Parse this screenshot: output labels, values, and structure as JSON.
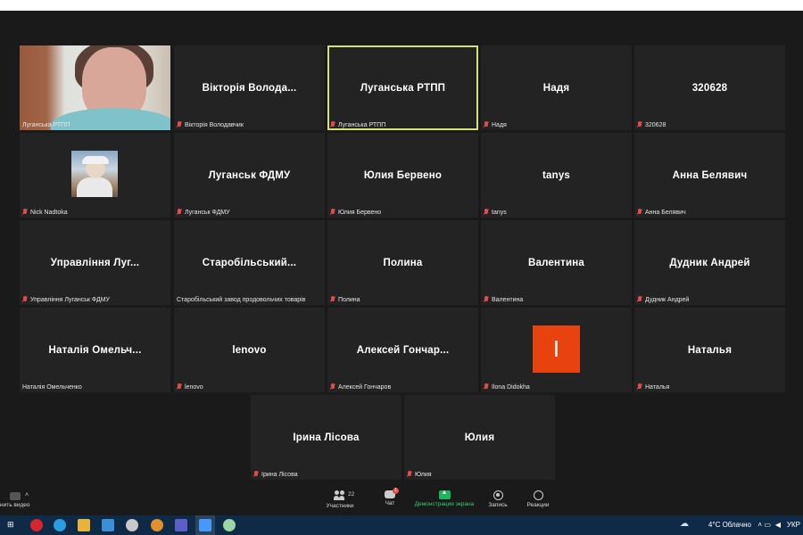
{
  "tiles": [
    {
      "name": "",
      "label": "Луганська РТПП"
    },
    {
      "name": "Вікторія Волода...",
      "label": "Вікторія Володавчик"
    },
    {
      "name": "Луганська РТПП",
      "label": "Луганська РТПП"
    },
    {
      "name": "Надя",
      "label": "Надя"
    },
    {
      "name": "320628",
      "label": "320628"
    },
    {
      "name": "",
      "label": "Nick Nadtoka"
    },
    {
      "name": "Луганськ ФДМУ",
      "label": "Луганськ ФДМУ"
    },
    {
      "name": "Юлия Бервено",
      "label": "Юлия Бервено"
    },
    {
      "name": "tanys",
      "label": "tanys"
    },
    {
      "name": "Анна Белявич",
      "label": "Анна Белявич"
    },
    {
      "name": "Управління Луг...",
      "label": "Управління Луганськ ФДМУ"
    },
    {
      "name": "Старобільський...",
      "label": "Старобільський завод продовольчих товарів"
    },
    {
      "name": "Полина",
      "label": "Полина"
    },
    {
      "name": "Валентина",
      "label": "Валентина"
    },
    {
      "name": "Дудник Андрей",
      "label": "Дудник Андрей"
    },
    {
      "name": "Наталія Омельч...",
      "label": "Наталія Омельченко"
    },
    {
      "name": "lenovo",
      "label": "lenovo"
    },
    {
      "name": "Алексей Гончар...",
      "label": "Алексей Гончаров"
    },
    {
      "name": "",
      "label": "Ilona Didokha",
      "avatar": "I"
    },
    {
      "name": "Наталья",
      "label": "Наталья"
    },
    {
      "name": "Ірина Лісова",
      "label": "Ірина Лісова"
    },
    {
      "name": "Юлия",
      "label": "Юлия"
    }
  ],
  "controls": {
    "video_label": "нить видео",
    "participants_label": "Участники",
    "participants_count": "22",
    "chat_label": "Чат",
    "chat_badge": "1",
    "share_label": "Демонстрация экрана",
    "record_label": "Запись",
    "reactions_label": "Реакции"
  },
  "taskbar": {
    "weather": "4°C  Облачно",
    "lang": "УКР"
  },
  "colors": {
    "active_border": "#d6e07a",
    "share_green": "#1fb35b",
    "avatar_orange": "#e8420e"
  }
}
